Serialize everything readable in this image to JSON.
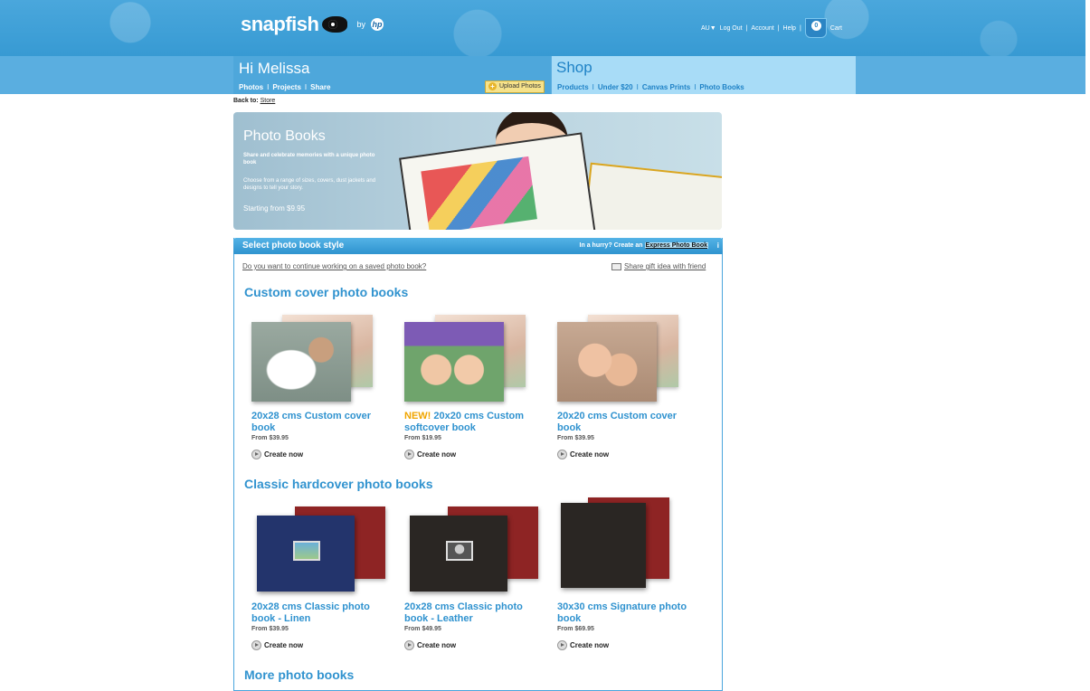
{
  "header": {
    "logo_text": "snapfish",
    "by_label": "by",
    "hp_label": "hp",
    "region": "AU",
    "region_arrow": "▼",
    "logout": "Log Out",
    "account": "Account",
    "help": "Help",
    "divider": "|",
    "cart_count": "0",
    "cart_label": "Cart"
  },
  "nav": {
    "greeting": "Hi Melissa",
    "links": [
      "Photos",
      "Projects",
      "Share"
    ],
    "upload_label": "Upload Photos",
    "upload_icon": "+",
    "shop_title": "Shop",
    "shop_links": [
      "Products",
      "Under $20",
      "Canvas Prints",
      "Photo Books"
    ],
    "separator": "I"
  },
  "breadcrumb": {
    "prefix": "Back to:",
    "link": "Store"
  },
  "hero": {
    "title": "Photo Books",
    "subtitle": "Share and celebrate memories with a unique photo book",
    "description": "Choose from a range of sizes, covers, dust jackets and designs to tell your story.",
    "price": "Starting from $9.95"
  },
  "panel": {
    "title": "Select photo book style",
    "hurry_prefix": "In a hurry? Create an",
    "hurry_link": "Express Photo Book",
    "info_icon": "i",
    "saved_link": "Do you want to continue working on a saved photo book?",
    "share_link": "Share gift idea with friend"
  },
  "sections": {
    "custom": {
      "title": "Custom cover photo books",
      "items": [
        {
          "new": "",
          "name": "20x28 cms Custom cover book",
          "price": "From $39.95",
          "cta": "Create now"
        },
        {
          "new": "NEW!",
          "name": "20x20 cms Custom softcover book",
          "price": "From $19.95",
          "cta": "Create now"
        },
        {
          "new": "",
          "name": "20x20 cms Custom cover book",
          "price": "From $39.95",
          "cta": "Create now"
        }
      ]
    },
    "classic": {
      "title": "Classic hardcover photo books",
      "items": [
        {
          "name": "20x28 cms Classic photo book - Linen",
          "price": "From $39.95",
          "cta": "Create now"
        },
        {
          "name": "20x28 cms Classic photo book - Leather",
          "price": "From $49.95",
          "cta": "Create now"
        },
        {
          "name": "30x30 cms Signature photo book",
          "price": "From $69.95",
          "cta": "Create now"
        }
      ]
    },
    "more": {
      "title": "More photo books"
    }
  },
  "colors": {
    "brand_blue": "#3e9fd6",
    "accent_blue": "#2f92cf",
    "new_orange": "#f0a500"
  }
}
